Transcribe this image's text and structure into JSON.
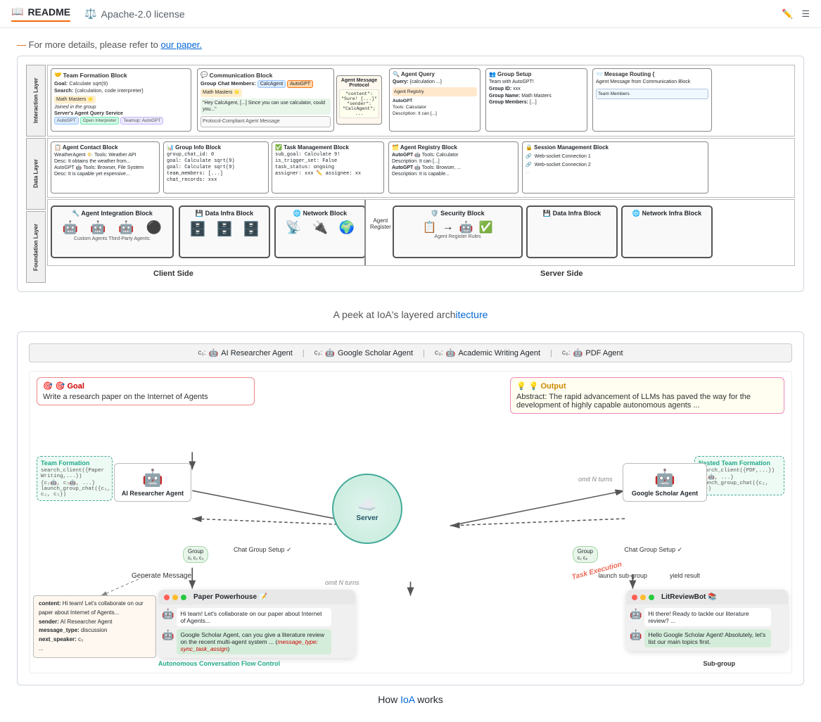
{
  "nav": {
    "readme_label": "README",
    "license_label": "Apache-2.0 license",
    "readme_icon": "📖",
    "license_icon": "⚖️"
  },
  "arch": {
    "top_link": "For more details, please refer to our paper.",
    "caption_prefix": "A peek at IoA's layered arch",
    "caption_highlight": "itecture",
    "layers": {
      "interaction": "Interaction Layer",
      "data": "Data Layer",
      "foundation": "Foundation Layer"
    },
    "interaction_blocks": [
      {
        "title": "Team Formation Block",
        "icon": "🤝"
      },
      {
        "title": "Communication Block",
        "icon": "💬"
      },
      {
        "title": "Agent Query",
        "icon": "🔍"
      },
      {
        "title": "Group Setup",
        "icon": "👥"
      },
      {
        "title": "Message Routing {",
        "icon": "📨"
      }
    ],
    "data_blocks": [
      {
        "title": "Agent Contact Block",
        "icon": "📋"
      },
      {
        "title": "Group Info Block",
        "icon": "📊"
      },
      {
        "title": "Task Management Block",
        "icon": "✅"
      },
      {
        "title": "Agent Registry Block",
        "icon": "🗂️"
      },
      {
        "title": "Session Management Block",
        "icon": "🔒"
      }
    ],
    "foundation_blocks": [
      {
        "title": "Agent Integration Block",
        "icon": "🔧"
      },
      {
        "title": "Data Infra Block",
        "icon": "💾"
      },
      {
        "title": "Network Block",
        "icon": "🌐"
      },
      {
        "title": "Security Block",
        "icon": "🛡️"
      },
      {
        "title": "Data Infra Block",
        "icon": "💾"
      },
      {
        "title": "Network Infra Block",
        "icon": "🌐"
      }
    ],
    "client_label": "Client Side",
    "server_label": "Server Side"
  },
  "ioa": {
    "agents": [
      {
        "id": "c1",
        "name": "AI Researcher Agent",
        "icon": "🤖"
      },
      {
        "id": "c2",
        "name": "Google Scholar Agent",
        "icon": "🤖"
      },
      {
        "id": "c3",
        "name": "Academic Writing Agent",
        "icon": "🤖"
      },
      {
        "id": "c6",
        "name": "PDF Agent",
        "icon": "🤖"
      }
    ],
    "goal": {
      "label": "🎯 Goal",
      "text": "Write a research paper on the Internet of Agents"
    },
    "output": {
      "label": "💡 Output",
      "text": "Abstract: The rapid advancement of LLMs has paved the way for the development of highly capable autonomous agents ..."
    },
    "team_formation": {
      "title": "Team Formation",
      "code1": "search_client({Paper Writing,...})",
      "code2": "{c₂🤖, c₃🤖, ...}",
      "code3": "launch_group_chat({c₁, c₂, c₃})"
    },
    "nested_team_formation": {
      "title": "Nested Team Formation",
      "code1": "search_client({PDF,...})",
      "code2": "{c₆🤖, ...}",
      "code3": "launch_group_chat({c₂, c₆})"
    },
    "server_label": "Server",
    "ai_agent_label": "AI Researcher Agent",
    "scholar_agent_label": "Google Scholar Agent",
    "generate_message": "Generate Message",
    "omit_n_turns_left": "omit N turns",
    "omit_n_turns_right": "omit N turns",
    "task_execution": "Task Execution",
    "launch_sub_group": "launch\nsub-group",
    "yield_result": "yield\nresult",
    "chat_paper": {
      "title": "Paper Powerhouse 📝",
      "messages": [
        "Hi team! Let's collaborate on our paper about Internet of Agents...",
        "Google Scholar Agent, can you give a literature review on the recent multi-agent system ... (message_type: sync_task_assign)"
      ]
    },
    "chat_litreview": {
      "title": "LitReviewBot 📚",
      "messages": [
        "Hi there! Ready to tackle our literature review? ...",
        "Hello Google Scholar Agent! Absolutely, let's list our main topics first."
      ]
    },
    "msg_content": {
      "content": "Hi team! Let's collaborate on our paper about Internet of Agents...",
      "sender": "AI Researcher Agent",
      "message_type": "discussion",
      "next_speaker": "c₃",
      "ellipsis": "..."
    },
    "autonomous_label": "Autonomous Conversation Flow Control",
    "subgroup_label": "Sub-group",
    "group_c1c2c3": "c₁ c₂ c₃",
    "group_c2c6": "c₂ c₆",
    "chat_group_setup1": "Chat Group Setup ✓",
    "chat_group_setup2": "Chat Group Setup ✓",
    "how_ioa_works": "How IoA works"
  }
}
